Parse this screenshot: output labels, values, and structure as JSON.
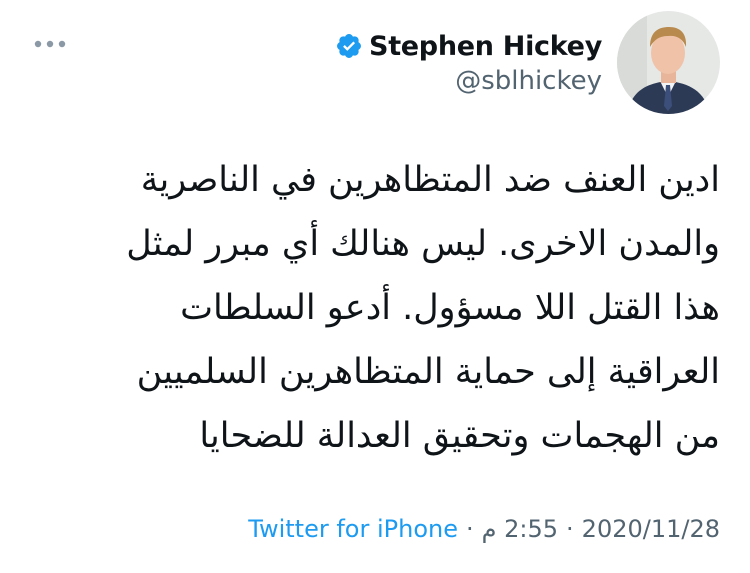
{
  "author": {
    "display_name": "Stephen Hickey",
    "handle": "@sblhickey",
    "verified": true
  },
  "tweet": {
    "lines": [
      "ادين العنف ضد المتظاهرين في الناصرية",
      "والمدن الاخرى. ليس هنالك أي مبرر لمثل",
      "هذا القتل اللا مسؤول.  أدعو السلطات",
      "العراقية إلى حماية المتظاهرين السلميين",
      "من الهجمات وتحقيق العدالة للضحايا"
    ]
  },
  "meta": {
    "source": "Twitter for iPhone",
    "separator": "·",
    "time": "2:55 م",
    "date": "2020/11/28"
  },
  "icons": {
    "more": "more-horizontal-icon",
    "verified": "verified-badge-icon"
  },
  "colors": {
    "verified": "#1d9bf0",
    "link": "#1d9bf0",
    "text": "#0f1419",
    "secondary": "#536471"
  }
}
